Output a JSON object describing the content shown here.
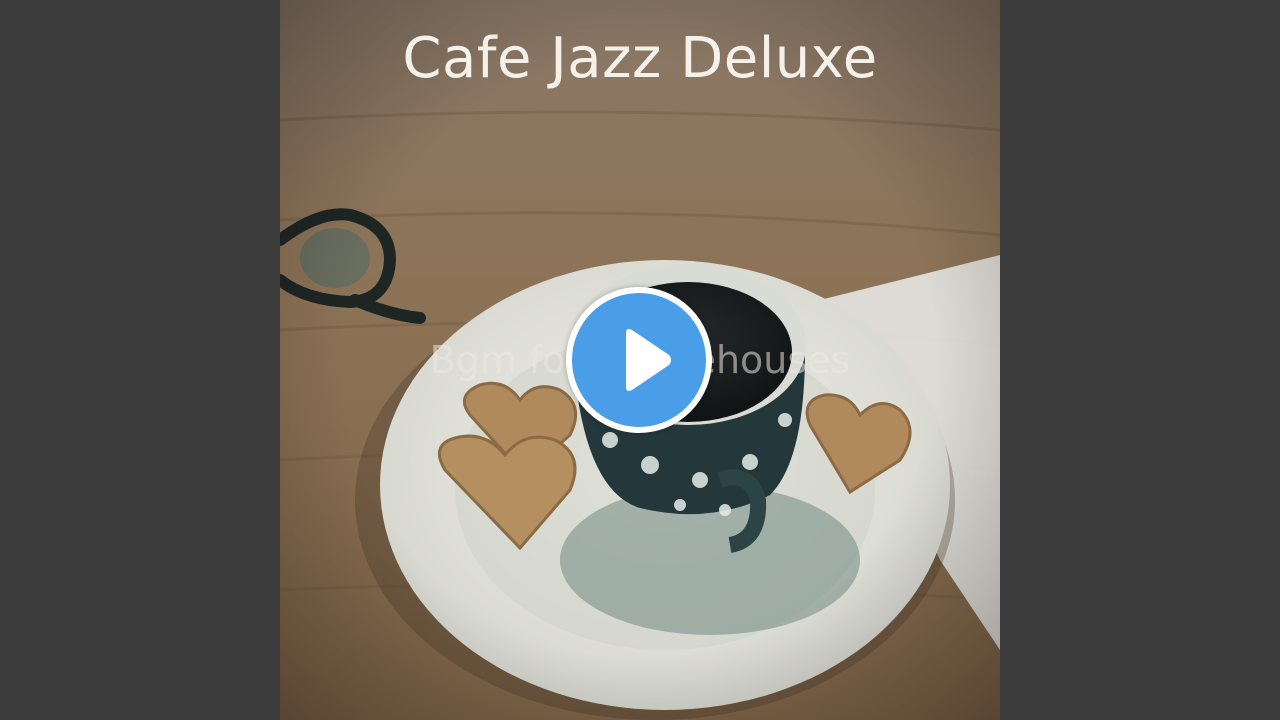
{
  "video": {
    "title": "Cafe Jazz Deluxe",
    "subtitle": "Bgm for Coffeehouses",
    "play_icon": "play-icon"
  },
  "colors": {
    "letterbox": "#3b3b3b",
    "play_button": "#4a9ee8",
    "play_button_border": "#ffffff"
  }
}
